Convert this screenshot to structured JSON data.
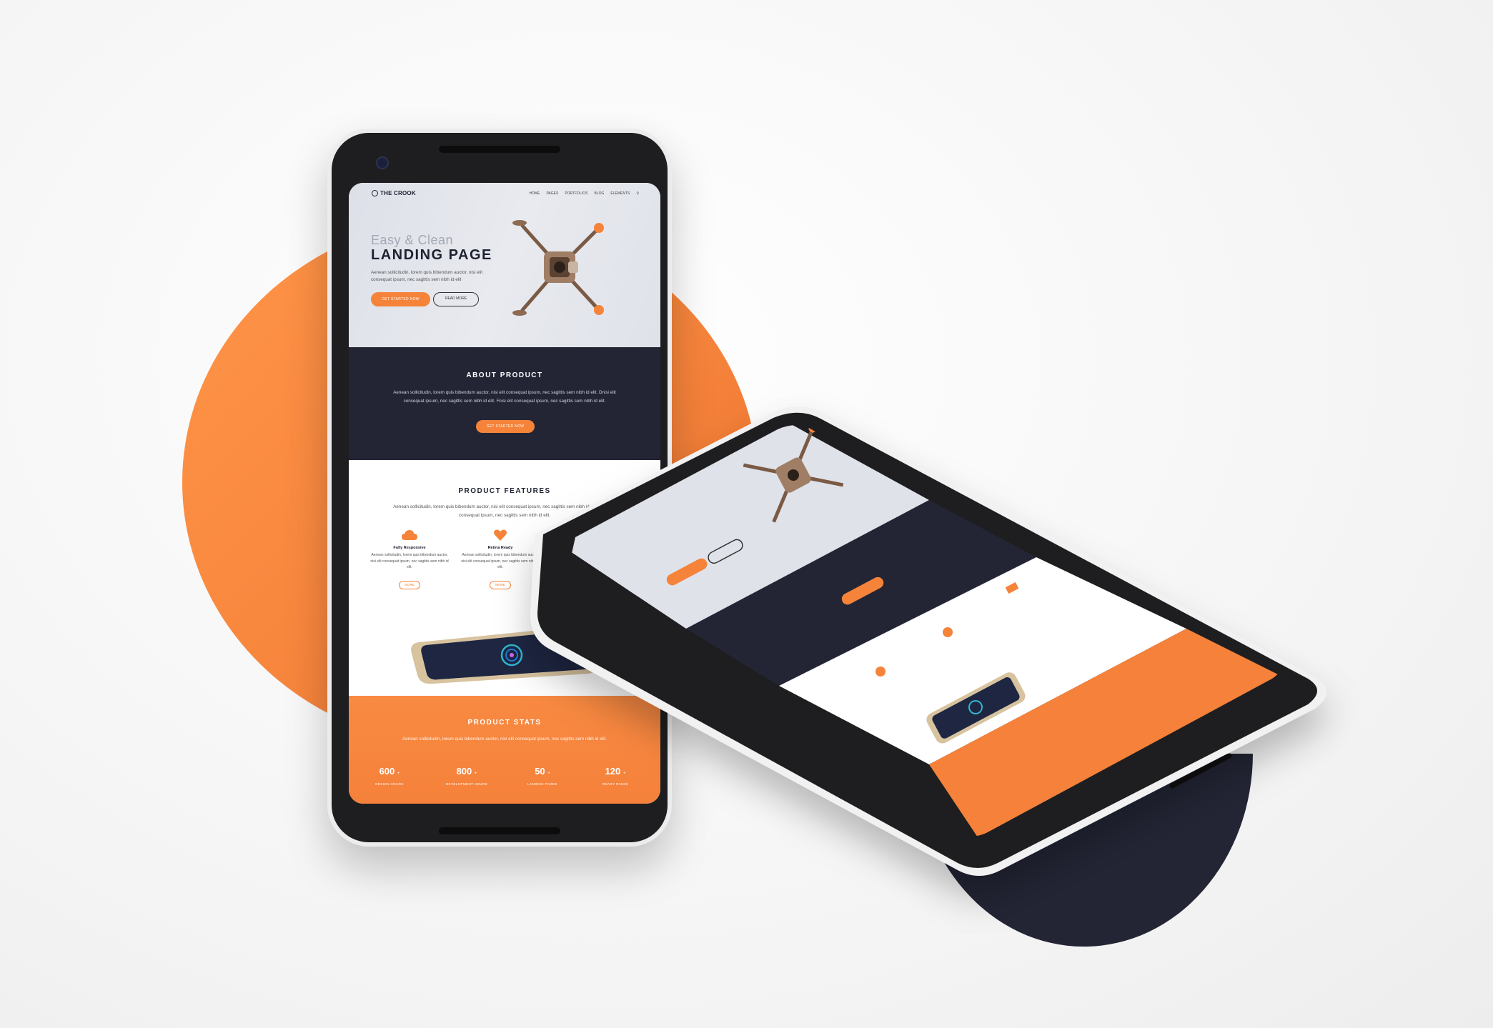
{
  "colors": {
    "accent": "#f58339",
    "navy": "#232535",
    "background": "#f4f4f4"
  },
  "phone": {
    "brand": "THE CROOK",
    "menu": [
      "HOME",
      "PAGES",
      "PORTFOLIOS",
      "BLOG",
      "ELEMENTS"
    ],
    "search_icon": "search-icon",
    "hero": {
      "subtitle": "Easy & Clean",
      "title": "LANDING PAGE",
      "text": "Aenean sollicitudin, lorem quis bibendum auctor, nisi elit consequat ipsum, nec sagittis sem nibh id elit",
      "primary_button": "GET STARTED NOW",
      "secondary_button": "READ MORE"
    },
    "about": {
      "title": "ABOUT PRODUCT",
      "text": "Aenean sollicitudin, lorem quis bibendum auctor, nisi elit consequat ipsum, nec sagittis sem nibh id elit. Dnisi elit consequat ipsum, nec sagittis sem nibh id elit. Fnisi elit consequat ipsum, nec sagittis sem nibh id elit.",
      "button": "GET STARTED NOW"
    },
    "features": {
      "title": "PRODUCT FEATURES",
      "text": "Aenean sollicitudin, lorem quis bibendum auctor, nisi elit consequat ipsum, nec sagittis sem nibh id elit. Dnisi elit consequat ipsum, nec sagittis sem nibh id elit.",
      "items": [
        {
          "icon": "cloud-icon",
          "title": "Fully Responsive",
          "text": "Aenean sollicitudin, lorem quis bibendum auctor, nisi elit consequat ipsum, nec sagittis sem nibh id elit.",
          "button": "MORE"
        },
        {
          "icon": "heart-icon",
          "title": "Retina Ready",
          "text": "Aenean sollicitudin, lorem quis bibendum auctor, nisi elit consequat ipsum, nec sagittis sem nibh id elit.",
          "button": "MORE"
        }
      ]
    },
    "stats": {
      "title": "PRODUCT STATS",
      "text": "Aenean sollicitudin, lorem quis bibendum auctor, nisi elit consequat ipsum, nec sagittis sem nibh id elit.",
      "items": [
        {
          "value": "600",
          "suffix": "+",
          "label": "DESIGN HOURS"
        },
        {
          "value": "800",
          "suffix": "+",
          "label": "DEVELOPMENT HOURS"
        },
        {
          "value": "50",
          "suffix": "+",
          "label": "LANDING PAGES"
        },
        {
          "value": "120",
          "suffix": "+",
          "label": "READY PAGES"
        }
      ]
    }
  }
}
